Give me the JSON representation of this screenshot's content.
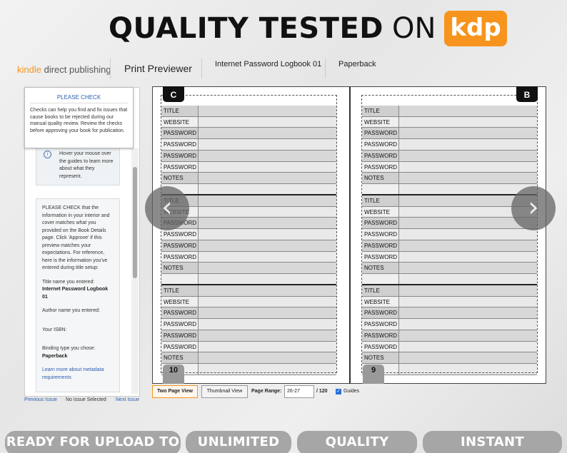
{
  "banner": {
    "title_bold": "QUALITY TESTED",
    "title_on": "ON",
    "kdp_badge": "kdp"
  },
  "header": {
    "logo_kindle": "kindle",
    "logo_rest": "direct publishing",
    "title": "Print Previewer",
    "book_title": "Internet Password Logbook 01",
    "format": "Paperback"
  },
  "sidebar": {
    "please_check_title": "PLEASE CHECK",
    "please_check_body": "Checks can help you find and fix issues that cause books to be rejected during our manual quality review. Review the checks before approving your book for publication.",
    "hover_text": "Hover your mouse over the guides to learn more about what they represent.",
    "info_icon": "i",
    "details_intro": "PLEASE CHECK that the information in your interior and cover matches what you provided on the Book Details page. Click 'Approve' if this preview matches your expectations. For reference, here is the information you've entered during title setup:",
    "title_label": "Title name you entered:",
    "title_value": "Internet Password Logbook 01",
    "author_label": "Author name you entered:",
    "isbn_label": "Your ISBN:",
    "binding_label": "Binding type you chose:",
    "binding_value": "Paperback",
    "metadata_link": "Learn more about metadata requirements",
    "previous_issue": "Previous Issue",
    "no_issue": "No Issue Selected",
    "next_issue": "Next Issue"
  },
  "preview": {
    "left_tab": "C",
    "right_tab": "B",
    "left_page_number": "10",
    "right_page_number": "9",
    "record_labels": [
      "TITLE",
      "WEBSITE",
      "PASSWORD",
      "PASSWORD",
      "PASSWORD",
      "PASSWORD",
      "NOTES"
    ],
    "prev_arrow": "‹",
    "next_arrow": "›"
  },
  "controls": {
    "two_page_view": "Two Page View",
    "thumbnail_view": "Thumbnail View",
    "page_range_label": "Page Range:",
    "page_range_value": "26-27",
    "page_total": "/ 120",
    "guides_label": "Guides",
    "guides_checked": true
  },
  "footer_pills": [
    "READY FOR UPLOAD TO KDP",
    "UNLIMITED USE",
    "QUALITY TESTED",
    "INSTANT DOWNLOAD"
  ]
}
